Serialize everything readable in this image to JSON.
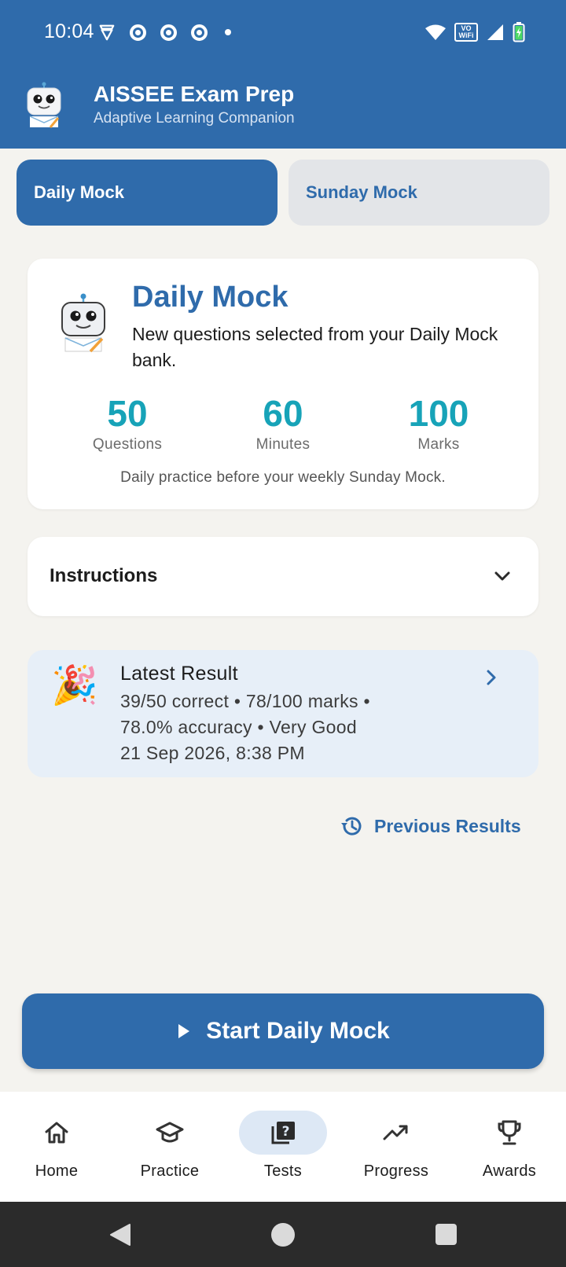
{
  "status_bar": {
    "time": "10:04",
    "left_icons": [
      "vpn-shield-icon",
      "chrome-icon",
      "chrome-icon",
      "chrome-icon",
      "notification-dot-icon"
    ],
    "right_icons": [
      "wifi-icon",
      "vowifi-icon",
      "cell-signal-icon",
      "battery-charging-icon"
    ],
    "vowifi_top": "VO",
    "vowifi_bottom": "WiFi"
  },
  "header": {
    "title": "AISSEE Exam Prep",
    "subtitle": "Adaptive Learning Companion",
    "background_color": "#2f6bab"
  },
  "tabs": [
    {
      "label": "Daily Mock",
      "selected": true
    },
    {
      "label": "Sunday Mock",
      "selected": false
    }
  ],
  "mock_card": {
    "title": "Daily Mock",
    "description": "New questions selected from your Daily Mock bank.",
    "stats": [
      {
        "value": "50",
        "label": "Questions"
      },
      {
        "value": "60",
        "label": "Minutes"
      },
      {
        "value": "100",
        "label": "Marks"
      }
    ],
    "footnote": "Daily practice before your weekly Sunday Mock.",
    "stat_color": "#17a3b8"
  },
  "instructions": {
    "label": "Instructions",
    "expanded": false
  },
  "latest_result": {
    "emoji": "🎉",
    "title": "Latest Result",
    "line1": "39/50 correct • 78/100 marks •",
    "line2": "78.0% accuracy • Very Good",
    "line3": "21 Sep 2026, 8:38 PM"
  },
  "previous_results": {
    "label": "Previous Results",
    "icon": "history-icon"
  },
  "start_button": {
    "label": "Start Daily Mock",
    "icon": "play-icon"
  },
  "bottom_nav": [
    {
      "label": "Home",
      "icon": "home-icon",
      "active": false
    },
    {
      "label": "Practice",
      "icon": "graduation-cap-icon",
      "active": false
    },
    {
      "label": "Tests",
      "icon": "quiz-icon",
      "active": true
    },
    {
      "label": "Progress",
      "icon": "trending-up-icon",
      "active": false
    },
    {
      "label": "Awards",
      "icon": "trophy-icon",
      "active": false
    }
  ]
}
